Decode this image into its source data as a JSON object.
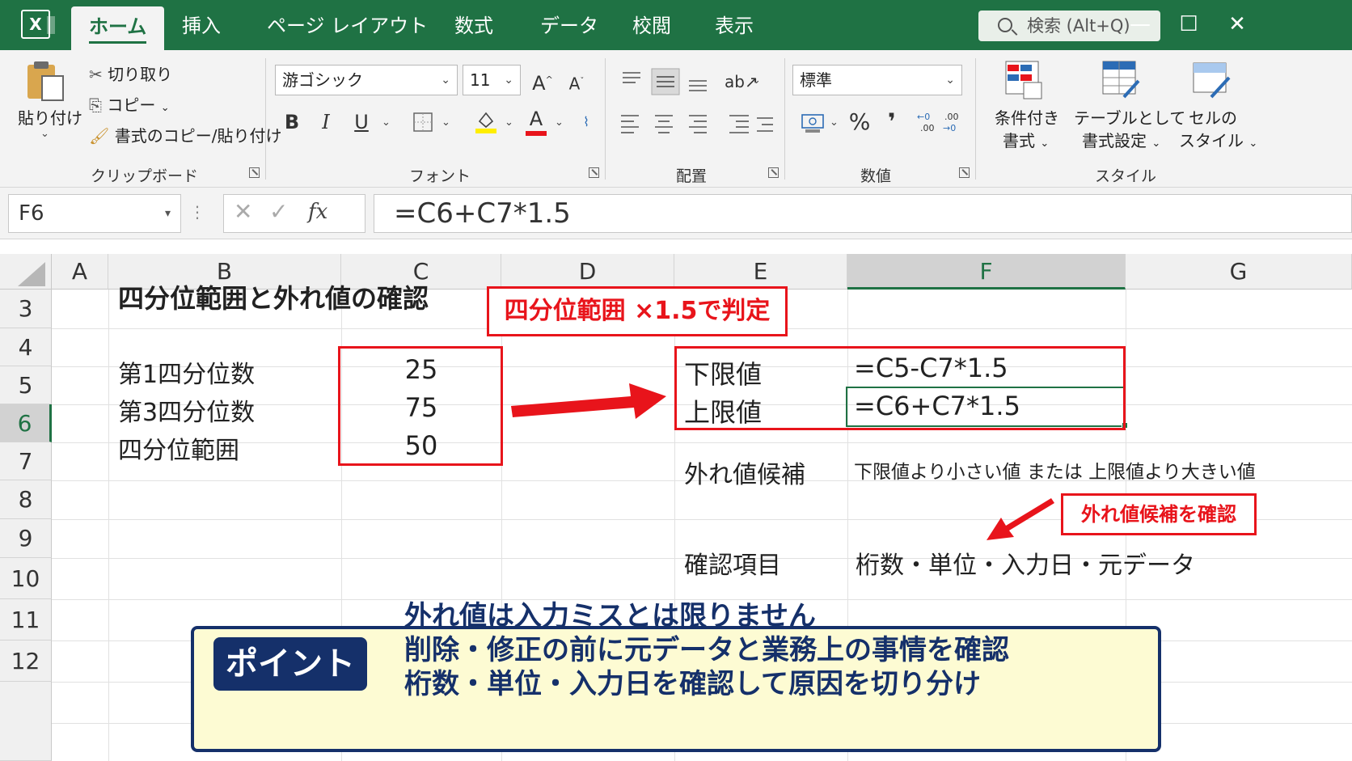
{
  "tabs": [
    "ホーム",
    "挿入",
    "ページ レイアウト",
    "数式",
    "データ",
    "校閲",
    "表示"
  ],
  "search_placeholder": "検索 (Alt+Q)",
  "window_controls": {
    "minimize": "—",
    "maximize": "☐",
    "close": "✕"
  },
  "ribbon": {
    "clipboard": {
      "paste": "貼り付け",
      "cut": "切り取り",
      "copy": "コピー",
      "format_painter": "書式のコピー/貼り付け",
      "group": "クリップボード"
    },
    "font": {
      "family": "游ゴシック",
      "size": "11",
      "bold": "B",
      "italic": "I",
      "underline": "U",
      "group": "フォント"
    },
    "alignment": {
      "group": "配置"
    },
    "number": {
      "format": "標準",
      "percent": "%",
      "comma": "❜",
      "group": "数値"
    },
    "styles": {
      "conditional_line1": "条件付き",
      "conditional_line2": "書式",
      "table_line1": "テーブルとして",
      "table_line2": "書式設定",
      "cell_line1": "セルの",
      "cell_line2": "スタイル",
      "group": "スタイル"
    }
  },
  "formula_bar": {
    "name_box": "F6",
    "fx": "fx",
    "formula": "=C6+C7*1.5"
  },
  "columns": [
    "A",
    "B",
    "C",
    "D",
    "E",
    "F",
    "G"
  ],
  "rows": [
    "3",
    "4",
    "5",
    "6",
    "7",
    "8",
    "9",
    "10",
    "11",
    "12"
  ],
  "sheet": {
    "title": "四分位範囲と外れ値の確認",
    "q1_label": "第1四分位数",
    "q1_value": "25",
    "q3_label": "第3四分位数",
    "q3_value": "75",
    "iqr_label": "四分位範囲",
    "iqr_value": "50",
    "callout_rule": "四分位範囲 ×1.5で判定",
    "lower_label": "下限値",
    "lower_formula": "=C5-C7*1.5",
    "upper_label": "上限値",
    "upper_formula": "=C6+C7*1.5",
    "outlier_label": "外れ値候補",
    "outlier_desc": "下限値より小さい値 または 上限値より大きい値",
    "callout_check": "外れ値候補を確認",
    "check_label": "確認項目",
    "check_items": "桁数・単位・入力日・元データ"
  },
  "point": {
    "badge": "ポイント",
    "line1": "外れ値は入力ミスとは限りません",
    "line2": "削除・修正の前に元データと業務上の事情を確認",
    "line3": "桁数・単位・入力日を確認して原因を切り分け"
  },
  "colors": {
    "excel_green": "#1f7244",
    "callout_red": "#e8141b",
    "point_navy": "#15306a",
    "point_bg": "#fdfbd3"
  }
}
